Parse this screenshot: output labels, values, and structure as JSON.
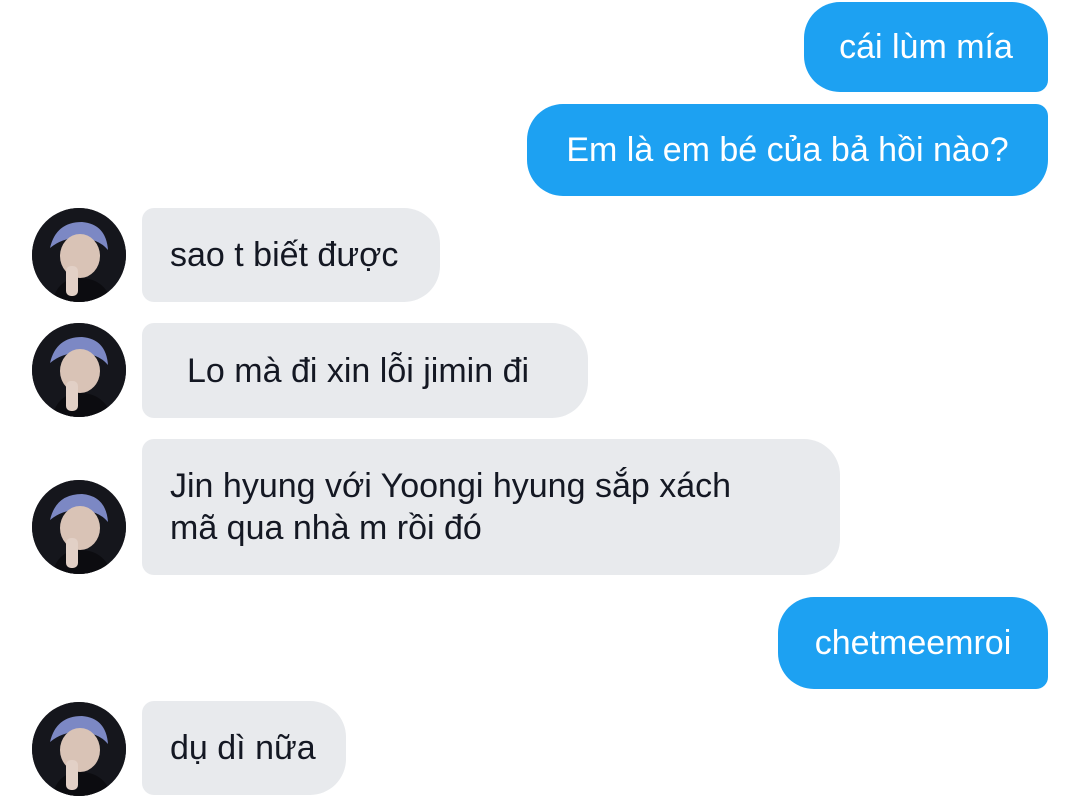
{
  "conversation": {
    "messages": [
      {
        "sender": "me",
        "text": "cái lùm mía"
      },
      {
        "sender": "me",
        "text": "Em là em bé của bả hồi nào?"
      },
      {
        "sender": "other",
        "text": "sao t biết được"
      },
      {
        "sender": "other",
        "text": "Lo mà đi xin lỗi jimin đi"
      },
      {
        "sender": "other",
        "text_lines": [
          "Jin hyung với Yoongi hyung sắp xách",
          "mã qua nhà m rồi đó"
        ]
      },
      {
        "sender": "me",
        "text": "chetmeemroi"
      },
      {
        "sender": "other",
        "text": "dụ dì nữa"
      }
    ]
  },
  "colors": {
    "sent_bubble": "#1da1f2",
    "received_bubble": "#e8eaed",
    "received_text": "#141823",
    "background": "#ffffff"
  }
}
